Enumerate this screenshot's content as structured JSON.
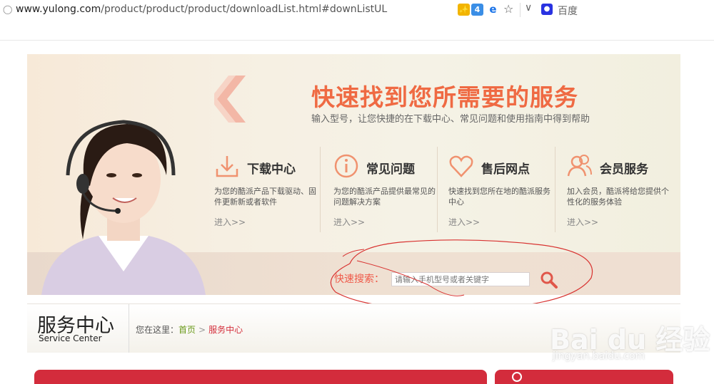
{
  "browser": {
    "url_domain": "www.yulong.com",
    "url_path": "/product/product/product/downloadList.html#downListUL",
    "ext_badge_count": "4",
    "search_engine_label": "百度"
  },
  "banner": {
    "headline": "快速找到您所需要的服务",
    "subline": "输入型号，让您快捷的在下载中心、常见问题和使用指南中得到帮助",
    "services": [
      {
        "title": "下载中心",
        "desc": "为您的酷派产品下载驱动、固件更新新或者软件",
        "enter": "进入>>"
      },
      {
        "title": "常见问题",
        "desc": "为您的酷派产品提供最常见的问题解决方案",
        "enter": "进入>>"
      },
      {
        "title": "售后网点",
        "desc": "快速找到您所在地的酷派服务中心",
        "enter": "进入>>"
      },
      {
        "title": "会员服务",
        "desc": "加入会员，酷派将给您提供个性化的服务体验",
        "enter": "进入>>"
      }
    ],
    "search_label": "快速搜索：",
    "search_placeholder": "请输入手机型号或者关键字"
  },
  "service_center": {
    "title_zh": "服务中心",
    "title_en": "Service Center",
    "crumb_prefix": "您在这里：",
    "crumb_home": "首页",
    "crumb_sep": ">",
    "crumb_current": "服务中心"
  },
  "watermark": {
    "main": "Bai du 经验",
    "sub": "jingyan.baidu.com"
  },
  "colors": {
    "accent": "#ef6a43",
    "tab_red": "#d32c3c",
    "breadcrumb_home": "#6a9a1a"
  }
}
